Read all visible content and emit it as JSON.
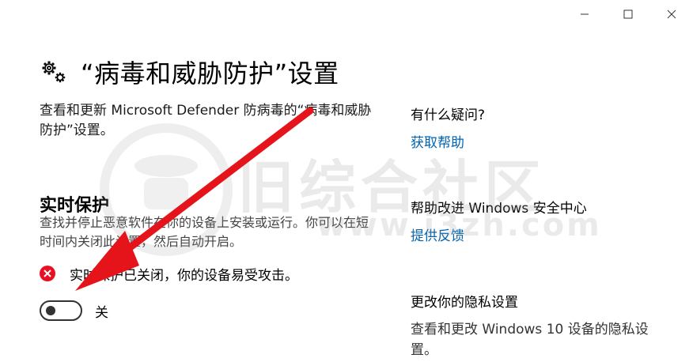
{
  "window": {
    "controls": {
      "minimize_icon": "minimize-icon",
      "maximize_icon": "maximize-icon",
      "close_icon": "close-icon"
    }
  },
  "header": {
    "icon": "gears-icon",
    "title": "“病毒和威胁防护”设置"
  },
  "description": "查看和更新 Microsoft Defender 防病毒的“病毒和威胁防护”设置。",
  "realtime": {
    "heading": "实时保护",
    "description": "查找并停止恶意软件在你的设备上安装或运行。你可以在短时间内关闭此设置，然后自动开启。",
    "warning_icon": "error-icon",
    "warning": "实时保护已关闭，你的设备易受攻击。",
    "toggle_on": false,
    "toggle_label": "关"
  },
  "sidebar": {
    "question_heading": "有什么疑问?",
    "help_link": "获取帮助",
    "improve_heading": "帮助改进 Windows 安全中心",
    "feedback_link": "提供反馈",
    "privacy_heading": "更改你的隐私设置",
    "privacy_desc": "查看和更改 Windows 10 设备的隐私设置。"
  },
  "watermark": {
    "text": "旧综合社区",
    "url": "www.i3zh.com"
  },
  "colors": {
    "accent_link": "#0063b1",
    "error_red": "#e81123",
    "arrow_red": "#e5141b"
  }
}
